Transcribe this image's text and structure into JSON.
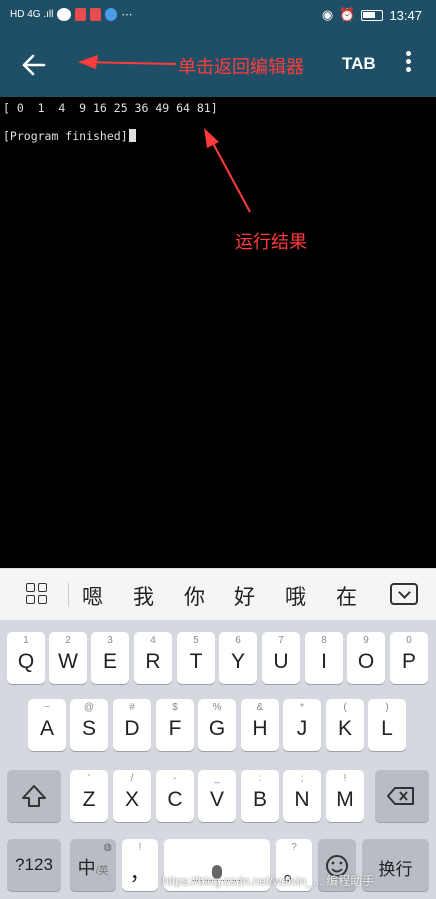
{
  "status_bar": {
    "left_indicators": "HD 4G .ıll",
    "time": "13:47"
  },
  "toolbar": {
    "back_icon": "arrow-left-icon",
    "tab_label": "TAB",
    "more_icon": "more-vertical-icon"
  },
  "terminal": {
    "output_line": "[ 0  1  4  9 16 25 36 49 64 81]",
    "finished_line": "[Program finished]"
  },
  "annotations": {
    "back_note": "单击返回编辑器",
    "result_note": "运行结果",
    "color": "#ff3b3b"
  },
  "candidates": {
    "items": [
      "嗯",
      "我",
      "你",
      "好",
      "哦",
      "在"
    ]
  },
  "keyboard": {
    "row1": [
      {
        "sub": "1",
        "main": "Q"
      },
      {
        "sub": "2",
        "main": "W"
      },
      {
        "sub": "3",
        "main": "E"
      },
      {
        "sub": "4",
        "main": "R"
      },
      {
        "sub": "5",
        "main": "T"
      },
      {
        "sub": "6",
        "main": "Y"
      },
      {
        "sub": "7",
        "main": "U"
      },
      {
        "sub": "8",
        "main": "I"
      },
      {
        "sub": "9",
        "main": "O"
      },
      {
        "sub": "0",
        "main": "P"
      }
    ],
    "row2": [
      {
        "sub": "~",
        "main": "A"
      },
      {
        "sub": "@",
        "main": "S"
      },
      {
        "sub": "#",
        "main": "D"
      },
      {
        "sub": "$",
        "main": "F"
      },
      {
        "sub": "%",
        "main": "G"
      },
      {
        "sub": "&",
        "main": "H"
      },
      {
        "sub": "*",
        "main": "J"
      },
      {
        "sub": "(",
        "main": "K"
      },
      {
        "sub": ")",
        "main": "L"
      }
    ],
    "row3": [
      {
        "sub": "'",
        "main": "Z"
      },
      {
        "sub": "/",
        "main": "X"
      },
      {
        "sub": "-",
        "main": "C"
      },
      {
        "sub": "_",
        "main": "V"
      },
      {
        "sub": ":",
        "main": "B"
      },
      {
        "sub": ";",
        "main": "N"
      },
      {
        "sub": "!",
        "main": "M"
      }
    ],
    "num_key": "?123",
    "lang_key": "中",
    "lang_sub": "/英",
    "comma_sub": "!",
    "comma_main": "，",
    "period_sub": "?",
    "period_main": "。",
    "enter_key": "换行"
  },
  "watermark": "https://blog.csdn.net/weixin_... 编程助手"
}
